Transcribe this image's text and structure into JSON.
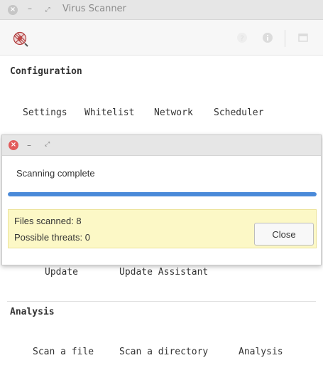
{
  "window": {
    "title": "Virus Scanner",
    "close_glyph": "×",
    "min_glyph": "–",
    "max_glyph": "⤢"
  },
  "toolbar": {
    "logo_icon": "virus-scanner-logo-icon",
    "icons": [
      "help-icon",
      "info-icon",
      "window-icon"
    ],
    "help_glyph": "?"
  },
  "configuration": {
    "title": "Configuration",
    "items": [
      "Settings",
      "Whitelist",
      "Network",
      "Scheduler"
    ]
  },
  "updates": {
    "items": [
      "Update",
      "Update Assistant"
    ]
  },
  "analysis": {
    "title": "Analysis",
    "items": [
      "Scan a file",
      "Scan a directory",
      "Analysis"
    ]
  },
  "dialog": {
    "close_glyph": "×",
    "min_glyph": "–",
    "max_glyph": "⤢",
    "status": "Scanning complete",
    "progress": 1.0,
    "files_scanned": "Files scanned: 8",
    "possible_threats": "Possible threats: 0",
    "close_label": "Close"
  },
  "colors": {
    "accent": "#4a8ad9",
    "info_bg": "#fcf8c6",
    "close_red": "#e25a5a"
  }
}
